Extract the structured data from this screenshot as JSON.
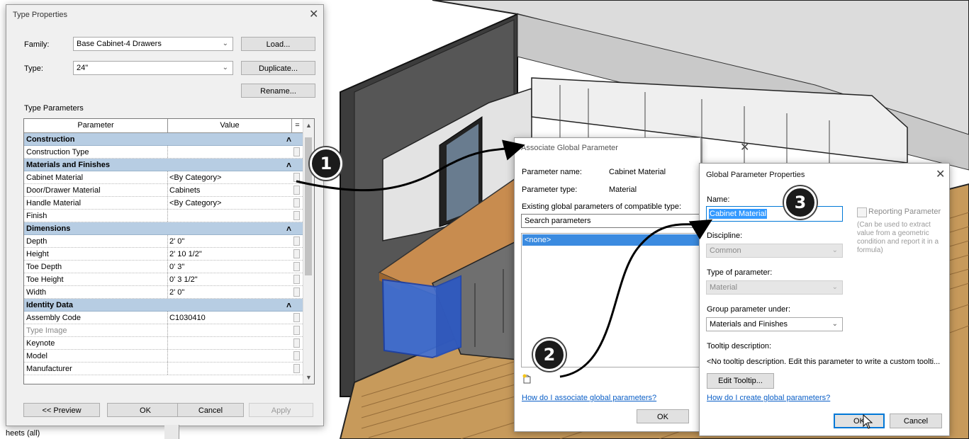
{
  "type_properties": {
    "title": "Type Properties",
    "family_label": "Family:",
    "family_value": "Base Cabinet-4 Drawers",
    "type_label": "Type:",
    "type_value": "24\"",
    "load_button": "Load...",
    "duplicate_button": "Duplicate...",
    "rename_button": "Rename...",
    "section_label": "Type Parameters",
    "columns": [
      "Parameter",
      "Value",
      "="
    ],
    "rows": [
      {
        "param": "Construction",
        "value": "",
        "group": true
      },
      {
        "param": "Construction Type",
        "value": ""
      },
      {
        "param": "Materials and Finishes",
        "value": "",
        "group": true
      },
      {
        "param": "Cabinet Material",
        "value": "<By Category>"
      },
      {
        "param": "Door/Drawer Material",
        "value": "Cabinets"
      },
      {
        "param": "Handle Material",
        "value": "<By Category>"
      },
      {
        "param": "Finish",
        "value": ""
      },
      {
        "param": "Dimensions",
        "value": "",
        "group": true
      },
      {
        "param": "Depth",
        "value": "2'  0\""
      },
      {
        "param": "Height",
        "value": "2'  10 1/2\""
      },
      {
        "param": "Toe Depth",
        "value": "0'  3\""
      },
      {
        "param": "Toe Height",
        "value": "0'  3 1/2\""
      },
      {
        "param": "Width",
        "value": "2'  0\""
      },
      {
        "param": "Identity Data",
        "value": "",
        "group": true
      },
      {
        "param": "Assembly Code",
        "value": "C1030410"
      },
      {
        "param": "Type Image",
        "value": "",
        "dim": true
      },
      {
        "param": "Keynote",
        "value": ""
      },
      {
        "param": "Model",
        "value": ""
      },
      {
        "param": "Manufacturer",
        "value": ""
      }
    ],
    "preview_button": "<< Preview",
    "ok_button": "OK",
    "cancel_button": "Cancel",
    "apply_button": "Apply",
    "bottom_text": "heets (all)"
  },
  "associate_dialog": {
    "title": "Associate Global Parameter",
    "param_name_label": "Parameter name:",
    "param_name_value": "Cabinet Material",
    "param_type_label": "Parameter type:",
    "param_type_value": "Material",
    "existing_label": "Existing global parameters of compatible type:",
    "search_value": "Search parameters",
    "list_items": [
      "<none>"
    ],
    "help_link": "How do I associate global parameters?",
    "ok_button": "OK"
  },
  "global_dialog": {
    "title": "Global Parameter Properties",
    "name_label": "Name:",
    "name_value": "Cabinet Material",
    "reporting_label": "Reporting Parameter",
    "reporting_note": "(Can be used to extract value from a geometric condition and report it in a formula)",
    "discipline_label": "Discipline:",
    "discipline_value": "Common",
    "type_label": "Type of parameter:",
    "type_value": "Material",
    "group_label": "Group parameter under:",
    "group_value": "Materials and Finishes",
    "tooltip_label": "Tooltip description:",
    "tooltip_value": "<No tooltip description. Edit this parameter to write a custom toolti...",
    "edit_tooltip_button": "Edit Tooltip...",
    "help_link": "How do I create global parameters?",
    "ok_button": "OK",
    "cancel_button": "Cancel"
  },
  "callouts": [
    "1",
    "2",
    "3"
  ]
}
